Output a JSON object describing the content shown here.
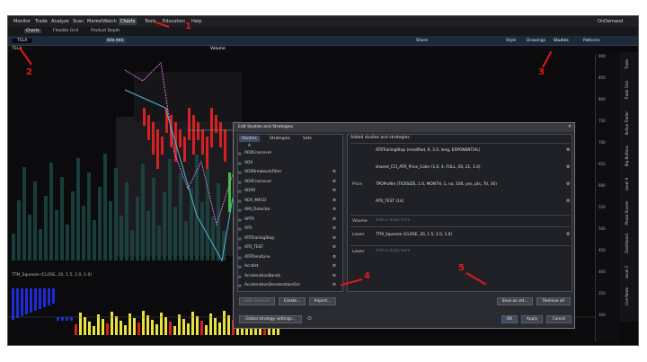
{
  "menu": {
    "items": [
      "Monitor",
      "Trade",
      "Analyze",
      "Scan",
      "MarketWatch",
      "Charts",
      "Tools",
      "Education",
      "Help"
    ],
    "active": "Charts",
    "right_label": "OnDemand"
  },
  "subtabs": [
    "Charts",
    "Flexible Grid",
    "Product Depth"
  ],
  "toolbar": {
    "symbol": "TSLA",
    "price": "694.940",
    "style_label": "Style",
    "drawings_label": "Drawings",
    "studies_label": "Studies",
    "patterns_label": "Patterns",
    "share_label": "Share",
    "volume_label": "Volume"
  },
  "axis_labels": [
    "900",
    "850",
    "800",
    "750",
    "700",
    "650",
    "600",
    "550",
    "500",
    "450",
    "400",
    "350",
    "300"
  ],
  "side_tabs": [
    "Trade",
    "Trade Grid",
    "Active Trader",
    "Big Buttons",
    "Level II",
    "Phase Scores",
    "Dashboard",
    "Level 2",
    "Live News"
  ],
  "lower_label": "TTM_Squeeze (CLOSE, 20, 1.5, 2.0, 1.0)",
  "dialog": {
    "title": "Edit Studies and Strategies",
    "tabs": [
      "Studies",
      "Strategies",
      "Sets"
    ],
    "search_placeholder": "A",
    "studies": [
      "ADXCrossover",
      "ADX",
      "ADXBreakoutsFilter",
      "ADXCrossover",
      "ADXR",
      "ADX_MACD",
      "AMI_Detector",
      "APTR",
      "ATR",
      "ATRTrailingStop",
      "ATR_TEST",
      "ATRTrendLine",
      "Accdist",
      "AccelerationBands",
      "AccelerationDecelerationOsc"
    ],
    "added_header": "Added studies and strategies",
    "price_label": "Price",
    "volume_label": "Volume",
    "lower_label": "Lower",
    "lower2_label": "Lower",
    "price_studies": [
      "ATRTrailingStop (modified, 9, 3.0, long, EXPONENTIAL)",
      "shared_CCI_ATR_Price_Color (1.0, 4, FULL, 50, 21, 1.0)",
      "TPOProfile (TICKSIZE, 1.0, MONTH, 1, no, 100, yes, pts, 70, 30)",
      "ATR_TEST (14)"
    ],
    "volume_placeholder": "Add a study here",
    "lower_studies": [
      "TTM_Squeeze (CLOSE, 20, 1.5, 2.0, 1.0)"
    ],
    "lower2_placeholder": "Add a study here",
    "buttons": {
      "add": "Add selected",
      "create": "Create...",
      "import": "Import...",
      "save_as_set": "Save as set...",
      "remove_all": "Remove all",
      "global": "Global strategy settings...",
      "ok": "OK",
      "apply": "Apply",
      "cancel": "Cancel"
    }
  },
  "annotations": [
    "1",
    "2",
    "3",
    "4",
    "5"
  ],
  "colors": {
    "marker": "#e01a1a",
    "candle_up": "#3cbf3c",
    "candle_down": "#d82020",
    "profile_line": "#c47bd8",
    "atr_line": "#4fb8d0",
    "squeeze_pos": "#e8e23a",
    "squeeze_neg": "#1f2bd4",
    "squeeze_dots": "#d82020"
  }
}
